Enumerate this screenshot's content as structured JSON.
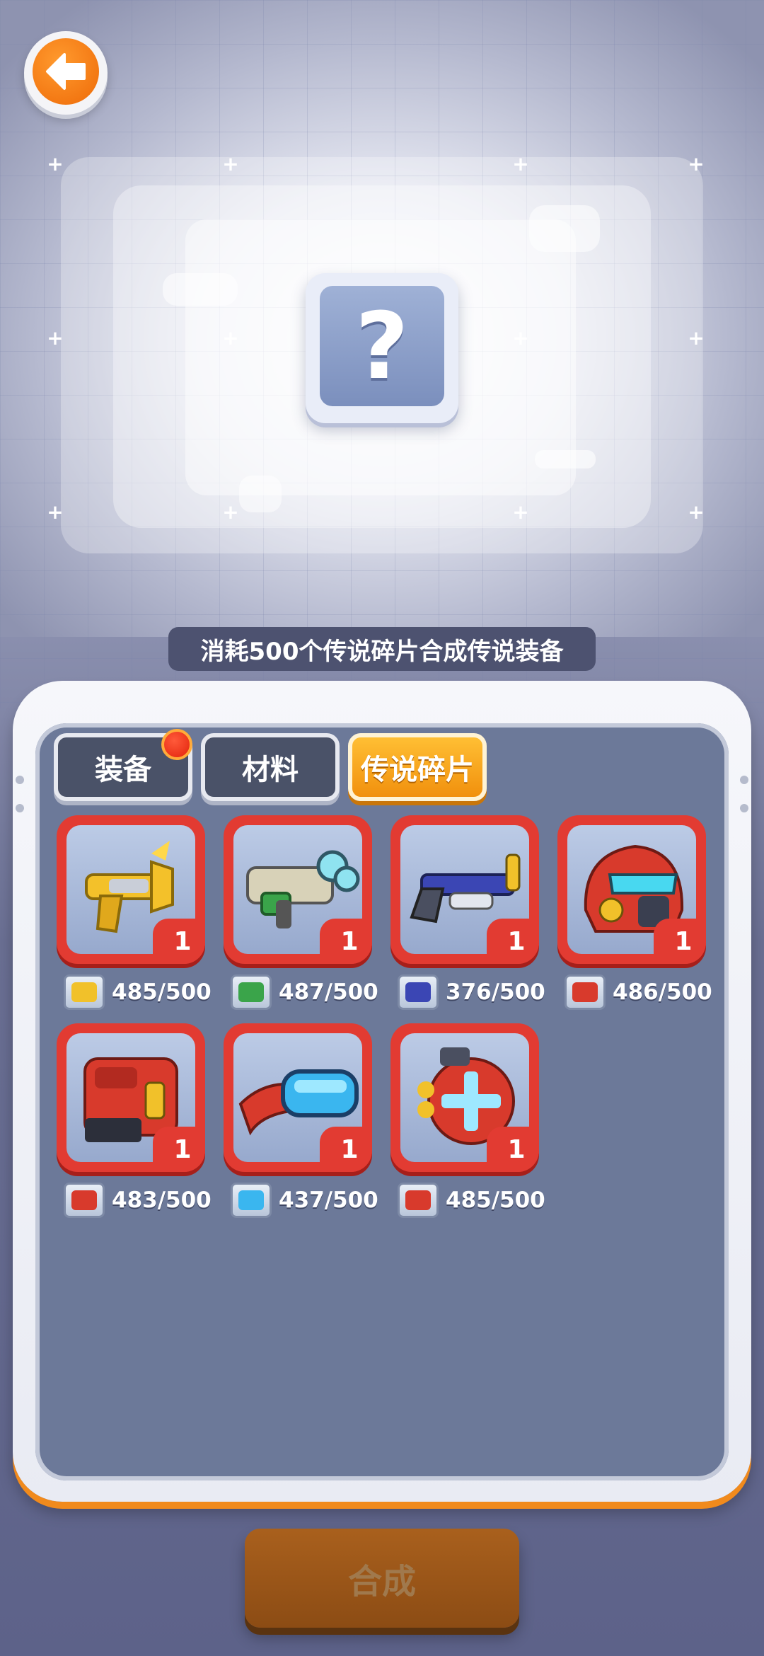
{
  "header": {
    "back_icon": "arrow-left-icon",
    "preview_placeholder": "?"
  },
  "hint_text": "消耗500个传说碎片合成传说装备",
  "tabs": [
    {
      "label": "装备",
      "active": false,
      "has_notification": true
    },
    {
      "label": "材料",
      "active": false,
      "has_notification": false
    },
    {
      "label": "传说碎片",
      "active": true,
      "has_notification": false
    }
  ],
  "items": [
    {
      "name": "golden-pistol",
      "count": "1",
      "progress": "485/500"
    },
    {
      "name": "green-blaster",
      "count": "1",
      "progress": "487/500"
    },
    {
      "name": "blue-shotgun",
      "count": "1",
      "progress": "376/500"
    },
    {
      "name": "red-helmet",
      "count": "1",
      "progress": "486/500"
    },
    {
      "name": "red-armor",
      "count": "1",
      "progress": "483/500"
    },
    {
      "name": "blue-goggles",
      "count": "1",
      "progress": "437/500"
    },
    {
      "name": "red-backpack",
      "count": "1",
      "progress": "485/500"
    }
  ],
  "synthesize_label": "合成",
  "colors": {
    "accent_orange": "#f1900d",
    "slot_red": "#e23b32",
    "panel_bg": "#6c7999"
  }
}
